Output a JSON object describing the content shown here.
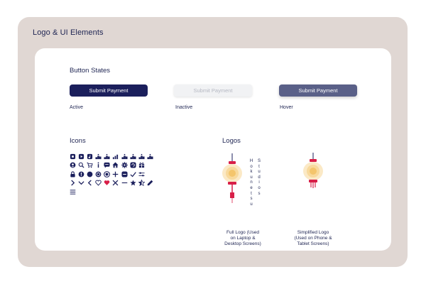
{
  "frame": {
    "title": "Logo & UI Elements"
  },
  "button_states": {
    "title": "Button States",
    "buttons": [
      {
        "label": "Submit Payment",
        "state_label": "Active"
      },
      {
        "label": "Submit Payment",
        "state_label": "Inactive"
      },
      {
        "label": "Submit Payment",
        "state_label": "Hover"
      }
    ]
  },
  "icons": {
    "title": "Icons",
    "rows": [
      [
        "square-stop-icon",
        "play-button-icon",
        "music-note-icon",
        "podium-icon",
        "podium-icon",
        "chart-icon",
        "podium-icon",
        "podium-icon",
        "podium-icon",
        "podium-icon"
      ],
      [
        "user-circle-icon",
        "search-icon",
        "cart-icon",
        "info-icon",
        "chat-icon",
        "home-icon",
        "gear-icon",
        "sync-icon",
        "gift-icon"
      ],
      [
        "lock-icon",
        "shield-icon",
        "globe-icon",
        "power-icon",
        "record-icon",
        "plus-icon",
        "minus-square-icon",
        "check-icon",
        "sliders-icon"
      ],
      [
        "chevron-right-icon",
        "chevron-down-icon",
        "chevron-left-icon",
        "heart-outline-icon",
        "heart-filled-icon",
        "close-icon",
        "minus-icon",
        "star-icon",
        "star-half-icon",
        "pencil-icon"
      ],
      [
        "menu-icon"
      ]
    ]
  },
  "logos": {
    "title": "Logos",
    "full_vertical_col1": [
      "H",
      "o",
      "k",
      "u",
      "n",
      "e",
      "t",
      "s",
      "u"
    ],
    "full_vertical_col2": [
      "S",
      "t",
      "u",
      "d",
      "i",
      "o",
      "s"
    ],
    "full_caption": [
      "Full Logo (Used",
      "on Laptop &",
      "Desktop Screens)"
    ],
    "simple_caption": [
      "Simplified Logo",
      "(Used on Phone &",
      "Tablet Screens)"
    ]
  },
  "colors": {
    "navy": "#1b1f5c",
    "hover": "#5a6088",
    "frame": "#e0d7d3",
    "lantern_red": "#d81f48",
    "lantern_glow": "#fbe9c6"
  }
}
